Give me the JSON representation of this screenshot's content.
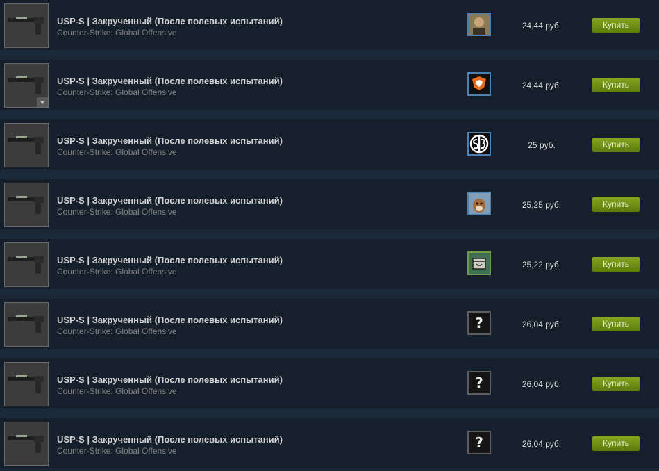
{
  "listings": [
    {
      "name": "USP-S | Закрученный (После полевых испытаний)",
      "game": "Counter-Strike: Global Offensive",
      "price": "24,44 руб.",
      "buy_label": "Купить",
      "avatar": "portrait"
    },
    {
      "name": "USP-S | Закрученный (После полевых испытаний)",
      "game": "Counter-Strike: Global Offensive",
      "price": "24,44 руб.",
      "buy_label": "Купить",
      "avatar": "virtus-pro-logo"
    },
    {
      "name": "USP-S | Закрученный (После полевых испытаний)",
      "game": "Counter-Strike: Global Offensive",
      "price": "25 руб.",
      "buy_label": "Купить",
      "avatar": "sb-logo"
    },
    {
      "name": "USP-S | Закрученный (После полевых испытаний)",
      "game": "Counter-Strike: Global Offensive",
      "price": "25,25 руб.",
      "buy_label": "Купить",
      "avatar": "dog-photo"
    },
    {
      "name": "USP-S | Закрученный (После полевых испытаний)",
      "game": "Counter-Strike: Global Offensive",
      "price": "25,22 руб.",
      "buy_label": "Купить",
      "avatar": "box-face"
    },
    {
      "name": "USP-S | Закрученный (После полевых испытаний)",
      "game": "Counter-Strike: Global Offensive",
      "price": "26,04 руб.",
      "buy_label": "Купить",
      "avatar": "question-mark"
    },
    {
      "name": "USP-S | Закрученный (После полевых испытаний)",
      "game": "Counter-Strike: Global Offensive",
      "price": "26,04 руб.",
      "buy_label": "Купить",
      "avatar": "question-mark"
    },
    {
      "name": "USP-S | Закрученный (После полевых испытаний)",
      "game": "Counter-Strike: Global Offensive",
      "price": "26,04 руб.",
      "buy_label": "Купить",
      "avatar": "question-mark"
    }
  ],
  "question_glyph": "?",
  "colors": {
    "accent_green": "#6e8f18",
    "background": "#1b2838",
    "row": "#16202d"
  }
}
